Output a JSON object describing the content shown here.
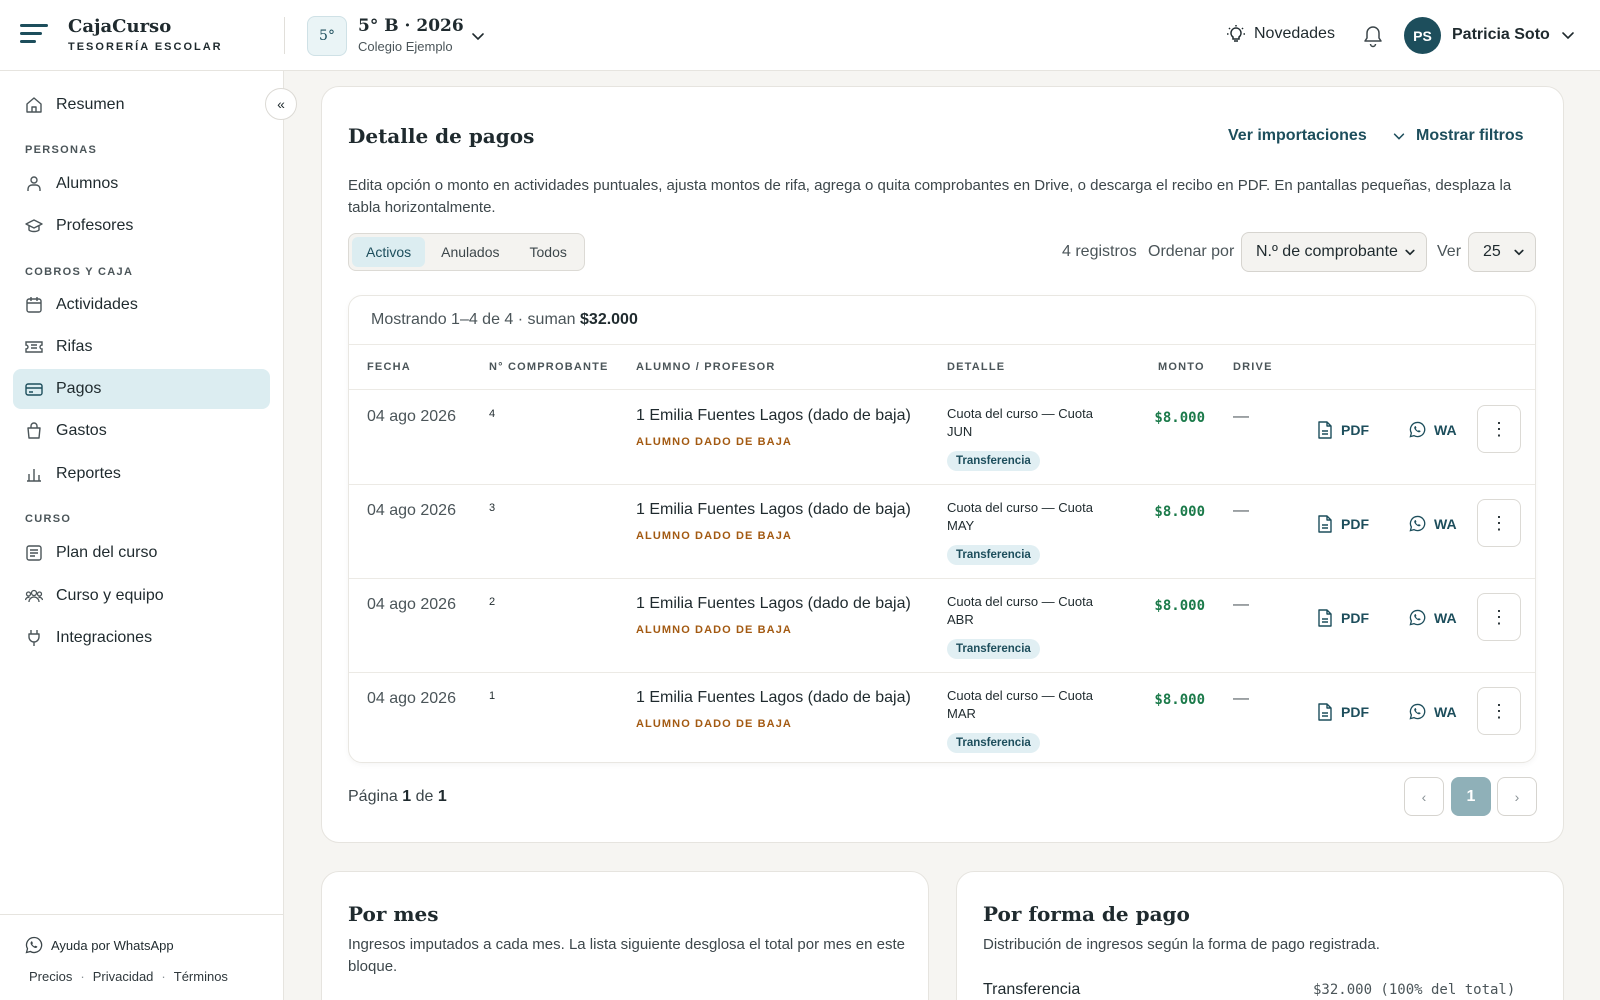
{
  "header": {
    "brand_name": "CajaCurso",
    "brand_sub": "TESORERÍA ESCOLAR",
    "course_badge": "5°",
    "course_title": "5° B · 2026",
    "course_school": "Colegio Ejemplo",
    "news_label": "Novedades",
    "user_initials": "PS",
    "user_name": "Patricia Soto"
  },
  "sidebar": {
    "collapse_glyph": "«",
    "top_item": "Resumen",
    "section_personas": "PERSONAS",
    "personas": [
      "Alumnos",
      "Profesores"
    ],
    "section_cobros": "COBROS Y CAJA",
    "cobros": [
      "Actividades",
      "Rifas",
      "Pagos",
      "Gastos",
      "Reportes"
    ],
    "section_curso": "CURSO",
    "curso": [
      "Plan del curso",
      "Curso y equipo",
      "Integraciones"
    ],
    "help": "Ayuda por WhatsApp",
    "legal": [
      "Precios",
      "Privacidad",
      "Términos"
    ],
    "legal_sep": "·"
  },
  "main": {
    "title": "Detalle de pagos",
    "link_imports": "Ver importaciones",
    "link_filters": "Mostrar filtros",
    "description": "Edita opción o monto en actividades puntuales, ajusta montos de rifa, agrega o quita comprobantes en Drive, o descarga el recibo en PDF. En pantallas pequeñas, desplaza la tabla horizontalmente.",
    "tabs": [
      "Activos",
      "Anulados",
      "Todos"
    ],
    "active_tab": "Activos",
    "record_count": "4 registros",
    "sort_label": "Ordenar por",
    "sort_value": "N.º de comprobante",
    "ver_label": "Ver",
    "ver_value": "25",
    "summary_prefix": "Mostrando 1–4 de 4 · suman",
    "summary_total": "$32.000",
    "columns": [
      "FECHA",
      "N° COMPROBANTE",
      "ALUMNO / PROFESOR",
      "DETALLE",
      "MONTO",
      "DRIVE"
    ],
    "rows": [
      {
        "date": "04 ago 2026",
        "num": "4",
        "name": "1 Emilia Fuentes Lagos (dado de baja)",
        "flag": "ALUMNO DADO DE BAJA",
        "detail": "Cuota del curso — Cuota JUN",
        "method": "Transferencia",
        "amount": "$8.000",
        "drive": "—",
        "pdf": "PDF",
        "wa": "WA"
      },
      {
        "date": "04 ago 2026",
        "num": "3",
        "name": "1 Emilia Fuentes Lagos (dado de baja)",
        "flag": "ALUMNO DADO DE BAJA",
        "detail": "Cuota del curso — Cuota MAY",
        "method": "Transferencia",
        "amount": "$8.000",
        "drive": "—",
        "pdf": "PDF",
        "wa": "WA"
      },
      {
        "date": "04 ago 2026",
        "num": "2",
        "name": "1 Emilia Fuentes Lagos (dado de baja)",
        "flag": "ALUMNO DADO DE BAJA",
        "detail": "Cuota del curso — Cuota ABR",
        "method": "Transferencia",
        "amount": "$8.000",
        "drive": "—",
        "pdf": "PDF",
        "wa": "WA"
      },
      {
        "date": "04 ago 2026",
        "num": "1",
        "name": "1 Emilia Fuentes Lagos (dado de baja)",
        "flag": "ALUMNO DADO DE BAJA",
        "detail": "Cuota del curso — Cuota MAR",
        "method": "Transferencia",
        "amount": "$8.000",
        "drive": "—",
        "pdf": "PDF",
        "wa": "WA"
      }
    ],
    "more_glyph": "⋮",
    "pager_prefix": "Página",
    "pager_current": "1",
    "pager_of": "de",
    "pager_total": "1",
    "pager_prev": "‹",
    "pager_next": "›"
  },
  "por_mes": {
    "title": "Por mes",
    "description": "Ingresos imputados a cada mes. La lista siguiente desglosa el total por mes en este bloque."
  },
  "por_forma": {
    "title": "Por forma de pago",
    "description": "Distribución de ingresos según la forma de pago registrada.",
    "label": "Transferencia",
    "value": "$32.000 (100% del total)"
  }
}
